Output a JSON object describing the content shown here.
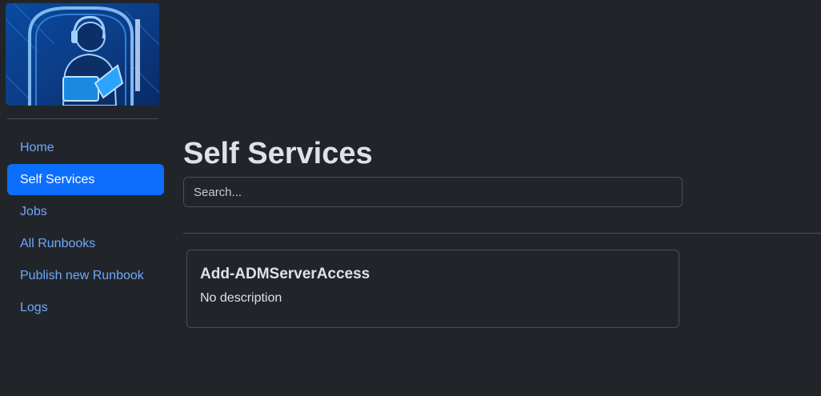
{
  "sidebar": {
    "logo_alt": "Portal logo",
    "nav": [
      {
        "label": "Home",
        "active": false
      },
      {
        "label": "Self Services",
        "active": true
      },
      {
        "label": "Jobs",
        "active": false
      },
      {
        "label": "All Runbooks",
        "active": false
      },
      {
        "label": "Publish new Runbook",
        "active": false
      },
      {
        "label": "Logs",
        "active": false
      }
    ]
  },
  "main": {
    "title": "Self Services",
    "search": {
      "placeholder": "Search...",
      "value": ""
    },
    "cards": [
      {
        "title": "Add-ADMServerAccess",
        "description": "No description"
      }
    ]
  },
  "colors": {
    "background": "#212529",
    "accent": "#0d6efd",
    "link": "#6ea8fe",
    "border": "#495057",
    "text": "#dee2e6"
  }
}
